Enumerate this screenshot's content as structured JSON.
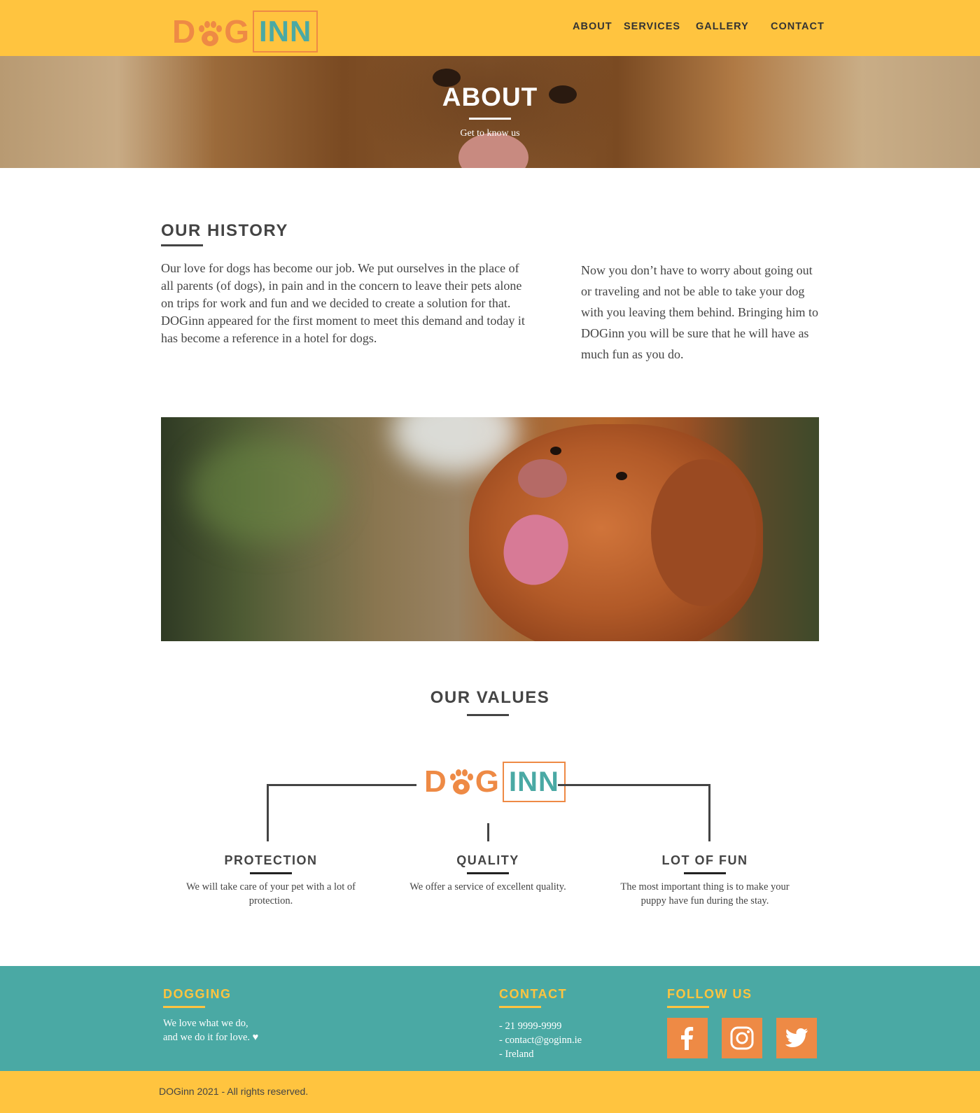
{
  "brand": {
    "logo_dog_pre": "D",
    "logo_dog_post": "G",
    "logo_inn": "INN"
  },
  "nav": {
    "about": "ABOUT",
    "services": "SERVICES",
    "gallery": "GALLERY",
    "contact": "CONTACT"
  },
  "hero": {
    "title": "ABOUT",
    "subtitle": "Get to know us"
  },
  "history": {
    "title": "OUR HISTORY",
    "paragraph_1": "Our love for dogs has become our job. We put ourselves in the place of all parents (of dogs), in pain and in the concern to leave their pets alone on trips for work and fun and we decided to create a solution for that. DOGinn appeared for the first moment to meet this demand and today it has become a reference in a hotel for dogs.",
    "paragraph_2": "Now you don’t have to worry about going out or traveling and not be able to take your dog with you leaving them behind. Bringing him to DOGinn you will be sure that he will have as much fun as you do."
  },
  "values": {
    "title": "OUR VALUES",
    "items": [
      {
        "title": "PROTECTION",
        "text": "We will take care of your pet with a lot of protection."
      },
      {
        "title": "QUALITY",
        "text": "We offer a service of excellent quality."
      },
      {
        "title": "LOT OF FUN",
        "text": "The most important thing is to make your puppy have fun during the stay."
      }
    ]
  },
  "footer": {
    "about_title": "DOGGING",
    "about_line_1": "We love what we do,",
    "about_line_2": "and we do it for love. ♥",
    "contact_title": "CONTACT",
    "phone": "- 21 9999-9999",
    "email": "- contact@goginn.ie",
    "country": "- Ireland",
    "follow_title": "FOLLOW US",
    "social_icons": [
      "facebook-icon",
      "instagram-icon",
      "twitter-icon"
    ],
    "copyright": "DOGinn 2021 - All rights reserved."
  },
  "colors": {
    "yellow": "#ffc43f",
    "orange": "#ee8a45",
    "teal": "#4aa9a4",
    "text": "#444444"
  }
}
